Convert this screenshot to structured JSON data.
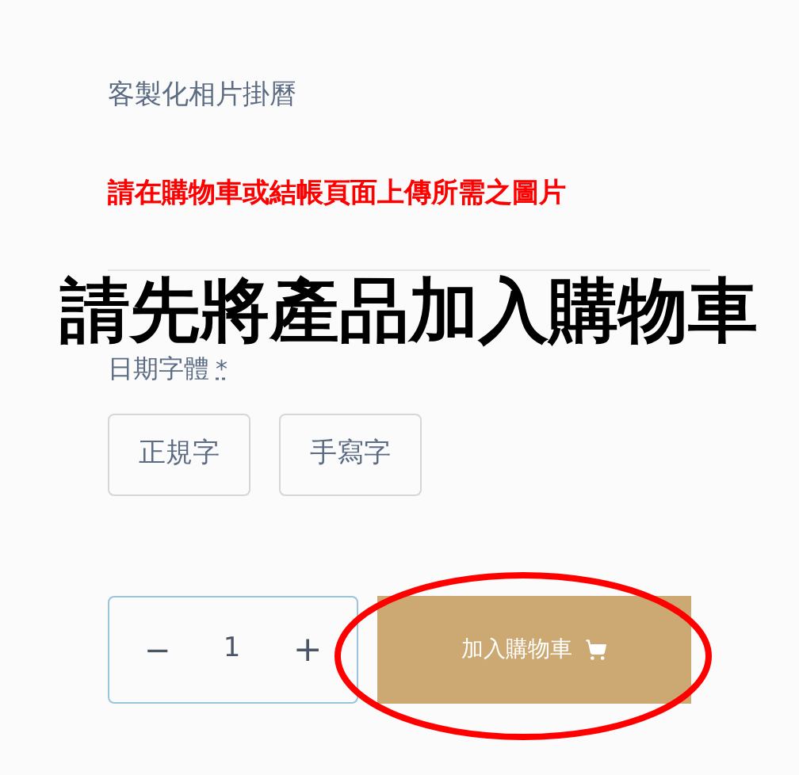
{
  "product_title": "客製化相片掛曆",
  "upload_notice": "請在購物車或結帳頁面上傳所需之圖片",
  "overlay_message": "請先將產品加入購物車",
  "date_font": {
    "label": "日期字體",
    "required_mark": "*",
    "options": [
      {
        "label": "正規字"
      },
      {
        "label": "手寫字"
      }
    ]
  },
  "quantity": {
    "decrement": "−",
    "value": "1",
    "increment": "+"
  },
  "add_to_cart": {
    "label": "加入購物車"
  }
}
